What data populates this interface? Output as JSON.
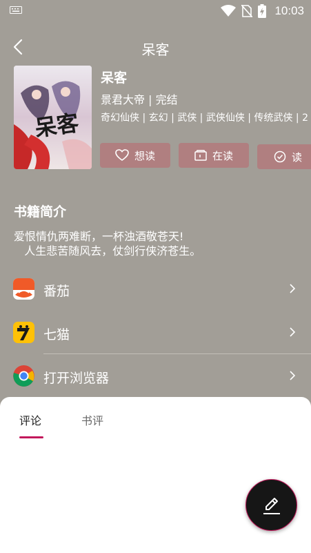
{
  "status_bar": {
    "time": "10:03"
  },
  "header": {
    "title": "呆客"
  },
  "book": {
    "name": "呆客",
    "author_status": "景君大帝 | 完结",
    "tags": "奇幻仙侠 | 玄幻 | 武侠 | 武侠仙侠 | 传统武侠 | 2",
    "cover_title": "呆客"
  },
  "actions": [
    {
      "label": "想读",
      "icon": "heart-icon"
    },
    {
      "label": "在读",
      "icon": "book-icon"
    },
    {
      "label": "读",
      "icon": "check-circle-icon"
    }
  ],
  "intro": {
    "title": "书籍简介",
    "text": "爱恨情仇两难断，一杯浊酒敬苍天!\n   人生悲苦随风去，仗剑行侠济苍生。"
  },
  "sources": [
    {
      "label": "番茄",
      "icon": "fanqie-app-icon"
    },
    {
      "label": "七猫",
      "icon": "qimao-app-icon"
    },
    {
      "label": "打开浏览器",
      "icon": "chrome-browser-icon"
    }
  ],
  "tabs": {
    "active": "评论",
    "inactive": "书评"
  },
  "colors": {
    "background": "#a29e97",
    "button": "#b07f80",
    "accent": "#c2185b",
    "fab": "#161616"
  }
}
